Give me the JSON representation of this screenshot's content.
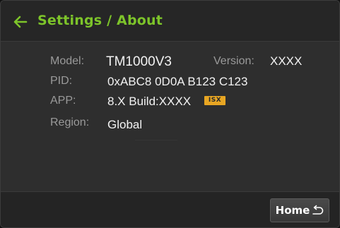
{
  "header": {
    "title": "Settings / About",
    "back_icon": "arrow-left-icon",
    "accent_color": "#7dc42a"
  },
  "about": {
    "model_label": "Model:",
    "model_value": "TM1000V3",
    "version_label": "Version:",
    "version_value": "XXXX",
    "pid_label": "PID:",
    "pid_value": "0xABC8 0D0A B123 C123",
    "app_label": "APP:",
    "app_value": "8.X Build:XXXX",
    "app_badge": "ISX",
    "badge_color": "#e8a623",
    "region_label": "Region:",
    "region_value": "Global"
  },
  "footer": {
    "home_label": "Home",
    "home_icon": "return-arrow-icon"
  }
}
